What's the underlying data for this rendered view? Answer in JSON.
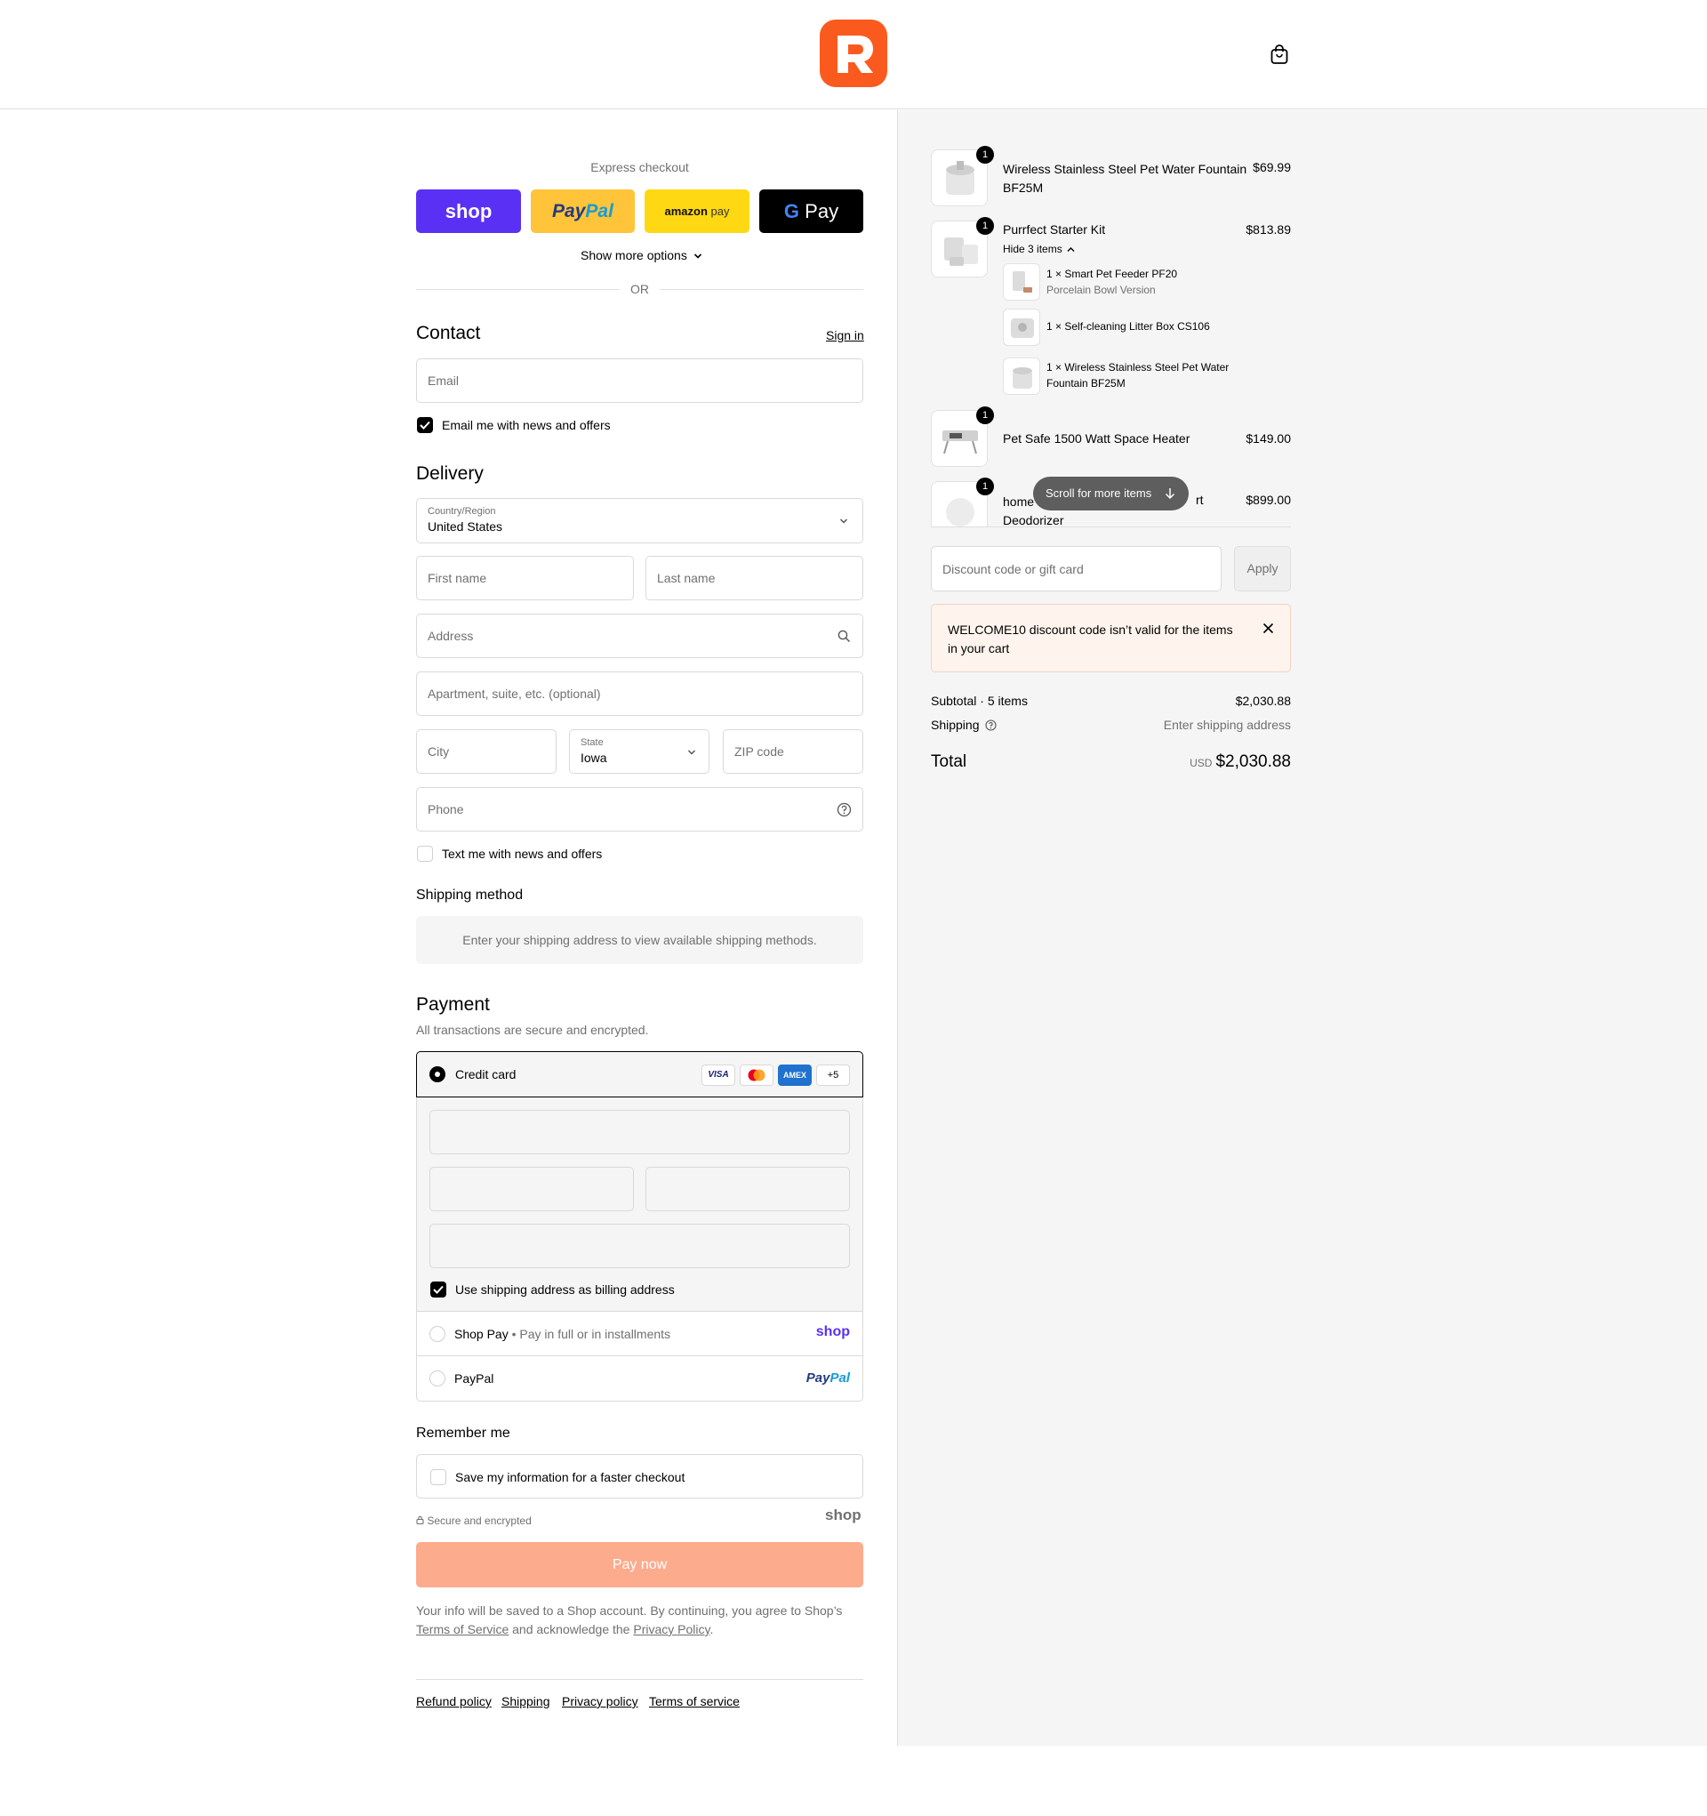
{
  "header": {
    "logo_icon": "brand-r-logo",
    "cart_icon": "shopping-bag-icon",
    "brand_color": "#fb5a1e"
  },
  "express": {
    "title": "Express checkout",
    "shop_label": "shop",
    "paypal_label_a": "Pay",
    "paypal_label_b": "Pal",
    "amazon_label_a": "amazon",
    "amazon_label_b": "pay",
    "gpay_label": "Pay",
    "show_more": "Show more options",
    "or": "OR"
  },
  "contact": {
    "title": "Contact",
    "sign_in": "Sign in",
    "email_placeholder": "Email",
    "news_label": "Email me with news and offers"
  },
  "delivery": {
    "title": "Delivery",
    "country_label": "Country/Region",
    "country_value": "United States",
    "first_name": "First name",
    "last_name": "Last name",
    "address": "Address",
    "apartment": "Apartment, suite, etc. (optional)",
    "city": "City",
    "state_label": "State",
    "state_value": "Iowa",
    "zip": "ZIP code",
    "phone": "Phone",
    "text_offers": "Text me with news and offers"
  },
  "shipping_method": {
    "title": "Shipping method",
    "message": "Enter your shipping address to view available shipping methods."
  },
  "payment": {
    "title": "Payment",
    "subtitle": "All transactions are secure and encrypted.",
    "credit_card": "Credit card",
    "visa": "VISA",
    "amex": "AMEX",
    "more_cards": "+5",
    "billing_label": "Use shipping address as billing address",
    "shop_pay": "Shop Pay",
    "shop_pay_sub": "Pay in full or in installments",
    "shop_pay_logo": "shop",
    "paypal": "PayPal",
    "paypal_logo_a": "Pay",
    "paypal_logo_b": "Pal"
  },
  "remember": {
    "title": "Remember me",
    "save_label": "Save my information for a faster checkout",
    "secure": "Secure and encrypted",
    "shop_logo": "shop"
  },
  "pay_now": {
    "label": "Pay now",
    "color": "#fcab8d"
  },
  "legal": {
    "line1": "Your info will be saved to a Shop account. By continuing, you agree to Shop’s",
    "tos": "Terms of Service",
    "mid": " and acknowledge the ",
    "privacy": "Privacy Policy",
    "end": "."
  },
  "footer": {
    "links": [
      "Refund policy",
      "Shipping",
      "Privacy policy",
      "Terms of service"
    ]
  },
  "cart": {
    "items": [
      {
        "qty": "1",
        "name_l1": "Wireless Stainless Steel Pet Water Fountain",
        "name_l2": "BF25M",
        "price": "$69.99"
      },
      {
        "qty": "1",
        "name_l1": "Purrfect Starter Kit",
        "price": "$813.89",
        "toggle": "Hide 3 items",
        "sub": [
          {
            "line1": "1 × Smart Pet Feeder PF20",
            "line2": "Porcelain Bowl Version"
          },
          {
            "line1": "1 × Self-cleaning Litter Box CS106",
            "line2": ""
          },
          {
            "line1": "1 × Wireless Stainless Steel Pet Water",
            "line2": "Fountain BF25M"
          }
        ]
      },
      {
        "qty": "1",
        "name_l1": "Pet Safe 1500 Watt Space Heater",
        "price": "$149.00"
      },
      {
        "qty": "1",
        "name_l1a": "home",
        "name_l1b": "rt",
        "name_l2": "Deodorizer",
        "price": "$899.00"
      }
    ],
    "scroll_pill": "Scroll for more items",
    "discount_placeholder": "Discount code or gift card",
    "apply": "Apply",
    "error": "WELCOME10 discount code isn’t valid for the items in your cart",
    "subtotal_label": "Subtotal · 5 items",
    "subtotal_value": "$2,030.88",
    "shipping_label": "Shipping",
    "shipping_value": "Enter shipping address",
    "total_label": "Total",
    "currency": "USD",
    "total_value": "$2,030.88"
  }
}
